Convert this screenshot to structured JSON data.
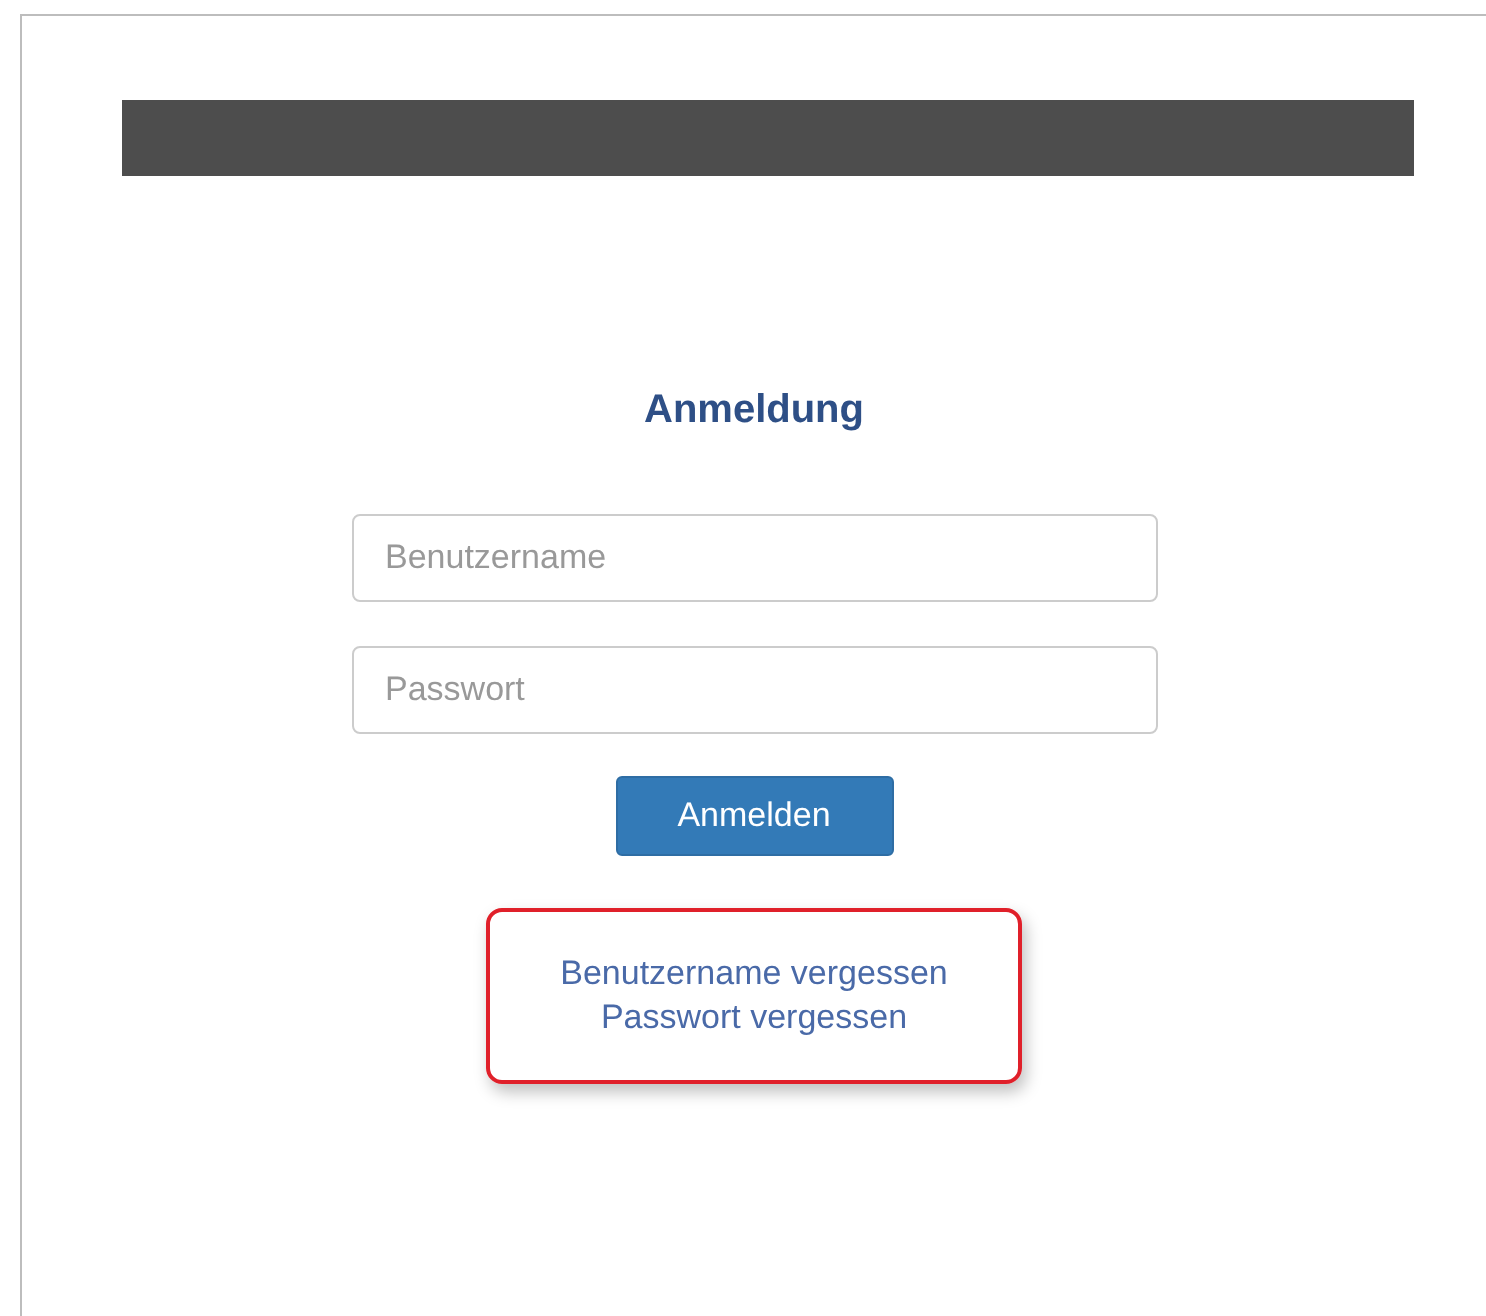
{
  "title": "Anmeldung",
  "fields": [
    {
      "placeholder": "Benutzername"
    },
    {
      "placeholder": "Passwort"
    }
  ],
  "login_button": "Anmelden",
  "links": {
    "highlighted": true,
    "items": [
      "Benutzername vergessen",
      "Passwort vergessen"
    ]
  }
}
